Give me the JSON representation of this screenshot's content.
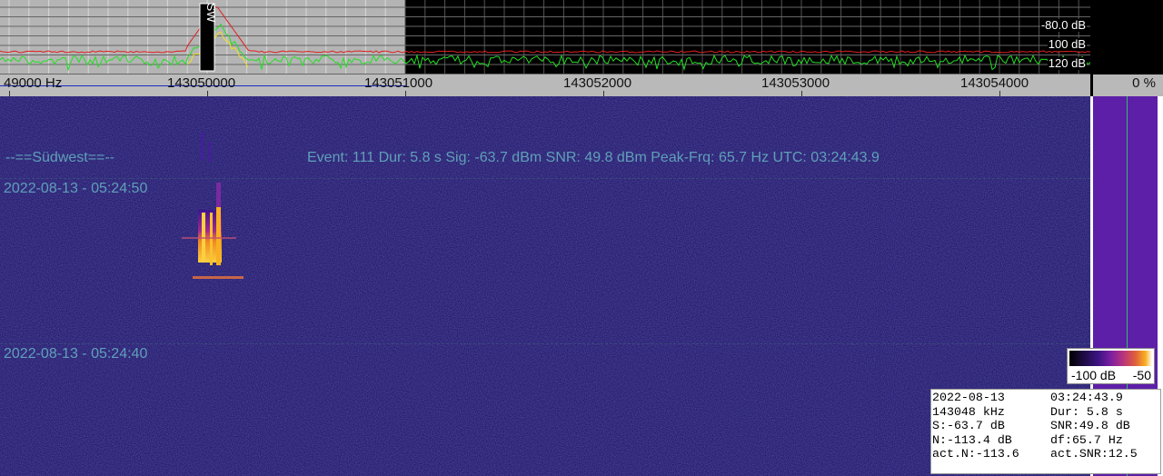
{
  "spectrum": {
    "db_labels": [
      "-80.0 dB",
      "100 dB",
      "120 dB"
    ],
    "marker_label": "SW"
  },
  "freq_axis": {
    "ticks": [
      "49000 Hz",
      "143050000",
      "143051000",
      "143052000",
      "143053000",
      "143054000"
    ],
    "percent": "0 %"
  },
  "waterfall": {
    "station": "--==Südwest==--",
    "event_line": "Event: 111   Dur: 5.8 s   Sig: -63.7 dBm   SNR: 49.8 dBm   Peak-Frq: 65.7 Hz   UTC: 03:24:43.9",
    "timestamps": [
      "2022-08-13 - 05:24:50",
      "2022-08-13 - 05:24:40"
    ]
  },
  "legend": {
    "min": "-100 dB",
    "max": "-50"
  },
  "info": {
    "rows": [
      [
        "2022-08-13",
        "03:24:43.9"
      ],
      [
        "143048 kHz",
        "Dur: 5.8 s"
      ],
      [
        "S:-63.7 dB",
        "SNR:49.8 dB"
      ],
      [
        "N:-113.4 dB",
        "df:65.7 Hz"
      ],
      [
        "act.N:-113.6",
        "act.SNR:12.5"
      ]
    ]
  },
  "colors": {
    "spectrum_trace": "#22e022",
    "peak_trace": "#e02020",
    "waterfall_bg": "#16125e",
    "level_bar": "#5d1ea8"
  }
}
